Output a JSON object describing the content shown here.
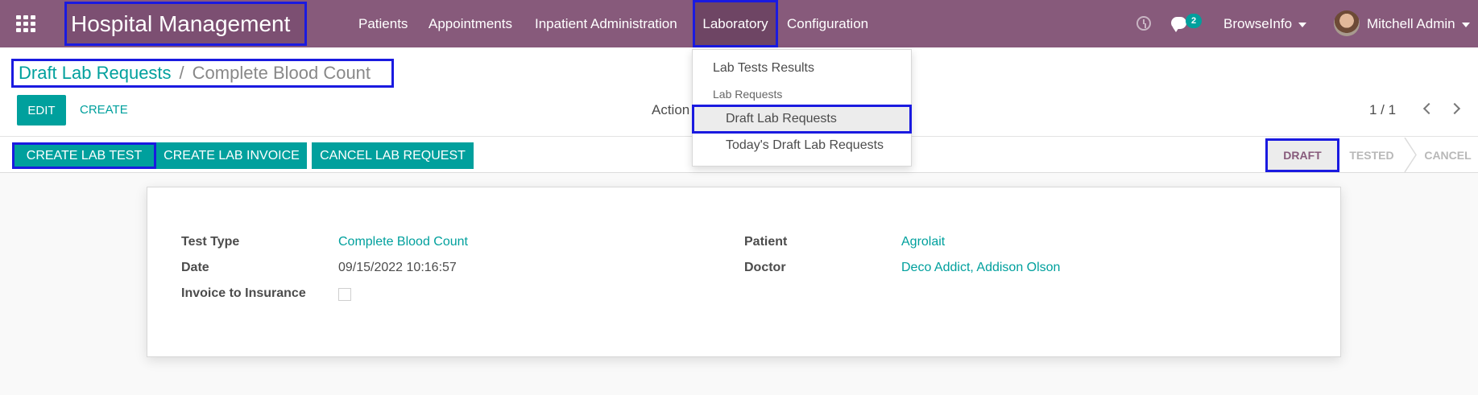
{
  "app": {
    "title": "Hospital Management"
  },
  "nav": {
    "items": [
      "Patients",
      "Appointments",
      "Inpatient Administration",
      "Laboratory",
      "Configuration"
    ],
    "active": "Laboratory",
    "messages_badge": "2",
    "company": "BrowseInfo",
    "user": "Mitchell Admin"
  },
  "breadcrumb": {
    "parent": "Draft Lab Requests",
    "separator": "/",
    "current": "Complete Blood Count"
  },
  "toolbar": {
    "edit_label": "EDIT",
    "create_label": "CREATE",
    "action_label": "Action",
    "pager": "1 / 1"
  },
  "statusbar": {
    "buttons": [
      "CREATE LAB TEST",
      "CREATE LAB INVOICE",
      "CANCEL LAB REQUEST"
    ],
    "stages": [
      "DRAFT",
      "TESTED",
      "CANCEL"
    ],
    "current_stage": "DRAFT"
  },
  "form": {
    "test_type_label": "Test Type",
    "test_type_value": "Complete Blood Count",
    "date_label": "Date",
    "date_value": "09/15/2022 10:16:57",
    "invoice_label": "Invoice to Insurance",
    "invoice_checked": false,
    "patient_label": "Patient",
    "patient_value": "Agrolait",
    "doctor_label": "Doctor",
    "doctor_value": "Deco Addict, Addison Olson"
  },
  "dropdown": {
    "items": [
      "Lab Tests Results"
    ],
    "section_header": "Lab Requests",
    "section_items": [
      "Draft Lab Requests",
      "Today's Draft Lab Requests"
    ],
    "highlighted": "Draft Lab Requests"
  },
  "colors": {
    "navbar": "#875a7b",
    "accent": "#00a09d",
    "highlight_border": "#1a1ae0"
  }
}
